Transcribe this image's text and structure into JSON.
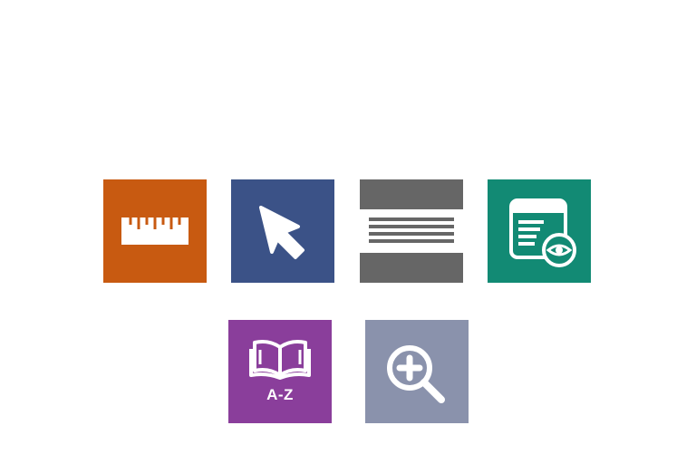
{
  "toolbar": {
    "tools": [
      {
        "id": "ruler",
        "icon": "ruler-icon",
        "color": "#C85A11"
      },
      {
        "id": "pointer",
        "icon": "cursor-arrow-icon",
        "color": "#3B5287"
      },
      {
        "id": "line-reader",
        "icon": "masking-lines-icon",
        "color": "#666666"
      },
      {
        "id": "preview",
        "icon": "document-eye-icon",
        "color": "#128A74"
      },
      {
        "id": "dictionary",
        "icon": "open-book-icon",
        "color": "#8A3E9B",
        "label": "A-Z"
      },
      {
        "id": "zoom",
        "icon": "zoom-in-icon",
        "color": "#8A92AC"
      }
    ]
  }
}
